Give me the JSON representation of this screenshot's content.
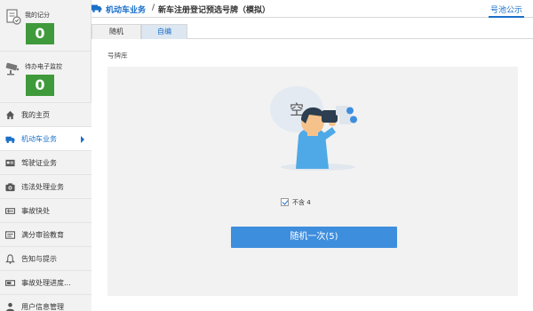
{
  "sidebar": {
    "score": {
      "label": "我的记分",
      "value": "0"
    },
    "surveillance": {
      "label": "待办电子监控",
      "value": "0"
    },
    "items": [
      {
        "label": "我的主页",
        "icon": "home-icon"
      },
      {
        "label": "机动车业务",
        "icon": "truck-icon",
        "active": true
      },
      {
        "label": "驾驶证业务",
        "icon": "license-card-icon"
      },
      {
        "label": "违法处理业务",
        "icon": "camera-icon"
      },
      {
        "label": "事故快处",
        "icon": "accident-icon"
      },
      {
        "label": "满分审验教育",
        "icon": "education-icon"
      },
      {
        "label": "告知与提示",
        "icon": "bell-icon"
      },
      {
        "label": "事故处理进度...",
        "icon": "progress-icon"
      },
      {
        "label": "用户信息管理",
        "icon": "user-icon"
      }
    ]
  },
  "header": {
    "crumb_root": "机动车业务",
    "separator": "/",
    "crumb_current": "新车注册登记预选号牌（模拟）",
    "notice_link": "号池公示"
  },
  "tabs": [
    {
      "label": "随机"
    },
    {
      "label": "自编",
      "selected": true
    }
  ],
  "main": {
    "pool_label": "号牌库",
    "empty_text": "空",
    "exclude_checkbox": {
      "label": "不含 4",
      "checked": true
    },
    "random_button": "随机一次(5)"
  },
  "colors": {
    "accent": "#1a6fc9",
    "score_green": "#3f9a3b",
    "button_blue": "#3e8ede"
  }
}
